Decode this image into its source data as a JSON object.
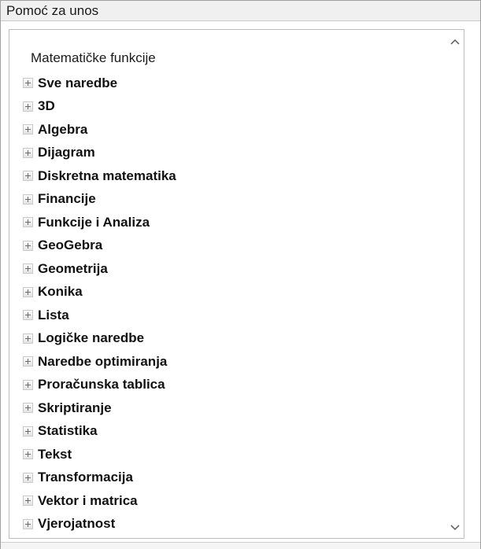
{
  "panel": {
    "title": "Pomoć za unos"
  },
  "tree": {
    "root_label": "Matematičke funkcije",
    "items": [
      {
        "label": "Sve naredbe"
      },
      {
        "label": "3D"
      },
      {
        "label": "Algebra"
      },
      {
        "label": "Dijagram"
      },
      {
        "label": "Diskretna matematika"
      },
      {
        "label": "Financije"
      },
      {
        "label": "Funkcije i Analiza"
      },
      {
        "label": "GeoGebra"
      },
      {
        "label": "Geometrija"
      },
      {
        "label": "Konika"
      },
      {
        "label": "Lista"
      },
      {
        "label": "Logičke naredbe"
      },
      {
        "label": "Naredbe optimiranja"
      },
      {
        "label": "Proračunska tablica"
      },
      {
        "label": "Skriptiranje"
      },
      {
        "label": "Statistika"
      },
      {
        "label": "Tekst"
      },
      {
        "label": "Transformacija"
      },
      {
        "label": "Vektor i matrica"
      },
      {
        "label": "Vjerojatnost"
      }
    ]
  },
  "scrollbar": {
    "up_icon": "chevron-up-icon",
    "down_icon": "chevron-down-icon"
  },
  "colors": {
    "header_bg": "#f0f0f0",
    "border": "#a0a0a0",
    "text": "#111111"
  }
}
